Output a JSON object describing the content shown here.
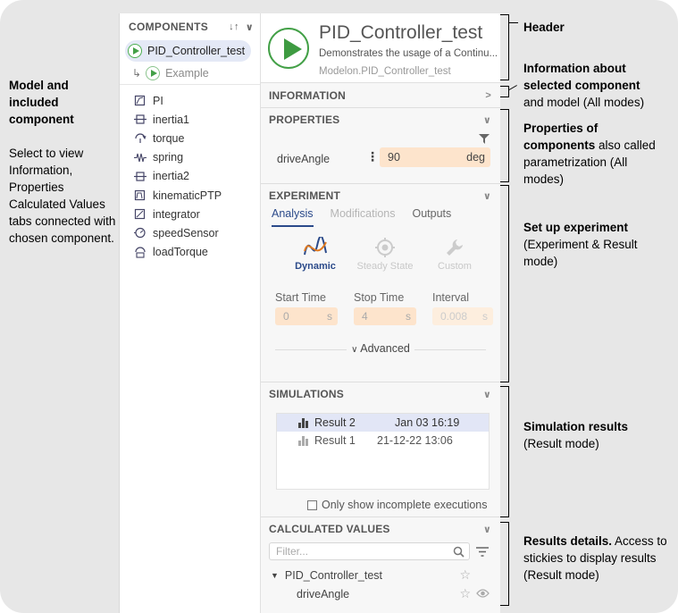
{
  "left_note": {
    "title": "Model and included component",
    "body": "Select to view Information, Properties Calculated Values tabs connected with chosen component."
  },
  "tree": {
    "header": "COMPONENTS",
    "selected_model": "PID_Controller_test",
    "example": "Example",
    "components": [
      "PI",
      "inertia1",
      "torque",
      "spring",
      "inertia2",
      "kinematicPTP",
      "integrator",
      "speedSensor",
      "loadTorque"
    ]
  },
  "header": {
    "title": "PID_Controller_test",
    "description": "Demonstrates the usage of a Continu...",
    "path": "Modelon.PID_Controller_test"
  },
  "information": {
    "label": "INFORMATION"
  },
  "properties": {
    "label": "PROPERTIES",
    "param_name": "driveAngle",
    "param_value": "90",
    "param_unit": "deg"
  },
  "experiment": {
    "label": "EXPERIMENT",
    "tabs": [
      "Analysis",
      "Modifications",
      "Outputs"
    ],
    "modes": [
      "Dynamic",
      "Steady State",
      "Custom"
    ],
    "start_label": "Start Time",
    "start_value": "0",
    "start_unit": "s",
    "stop_label": "Stop Time",
    "stop_value": "4",
    "stop_unit": "s",
    "interval_label": "Interval",
    "interval_value": "0.008",
    "interval_unit": "s",
    "advanced": "Advanced"
  },
  "simulations": {
    "label": "SIMULATIONS",
    "rows": [
      {
        "name": "Result 2",
        "date": "Jan 03  16:19"
      },
      {
        "name": "Result 1",
        "date": "21-12-22  13:06"
      }
    ],
    "checkbox": "Only show incomplete executions"
  },
  "calculated": {
    "label": "CALCULATED VALUES",
    "placeholder": "Filter...",
    "root": "PID_Controller_test",
    "leaf": "driveAngle"
  },
  "right_notes": {
    "header": "Header",
    "info_title": "Information about selected component",
    "info_body": "and model  (All modes)",
    "props_title": "Properties of components",
    "props_body": " also called parametrization (All modes)",
    "exp_title": "Set up experiment",
    "exp_body": "(Experiment & Result mode)",
    "sim_title": "Simulation results",
    "sim_body": "(Result mode)",
    "res_title": "Results details.",
    "res_body": " Access to stickies to display results (Result mode)"
  }
}
